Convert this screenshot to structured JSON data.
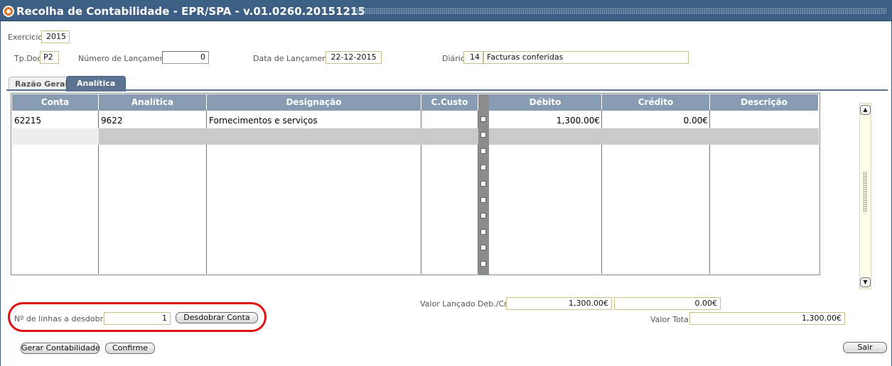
{
  "window": {
    "title": "Recolha de Contabilidade - EPR/SPA - v.01.0260.20151215"
  },
  "header": {
    "exercicio_label": "Exercicio",
    "exercicio_value": "2015",
    "tpdoc_label": "Tp.Doc.",
    "tpdoc_value": "P2",
    "numero_label": "Número de Lançamento:",
    "numero_value": "0",
    "data_label": "Data de Lançamento:",
    "data_value": "22-12-2015",
    "diario_label": "Diário:",
    "diario_code": "14",
    "diario_name": "Facturas conferidas"
  },
  "tabs": [
    {
      "label": "Razão Geral",
      "active": false
    },
    {
      "label": "Analítica",
      "active": true
    }
  ],
  "table": {
    "columns": [
      "Conta",
      "Analítica",
      "Designação",
      "C.Custo",
      "Débito",
      "Crédito",
      "Descrição"
    ],
    "rows": [
      {
        "conta": "62215",
        "analitica": "9622",
        "designacao": "Fornecimentos e serviços",
        "ccusto": "",
        "debito": "1,300.00€",
        "credito": "0.00€",
        "descricao": ""
      }
    ]
  },
  "totals": {
    "valor_lancado_label": "Valor Lançado Deb./Cre.",
    "valor_lancado_deb": "1,300.00€",
    "valor_lancado_cre": "0.00€",
    "valor_total_label": "Valor Total:",
    "valor_total": "1,300.00€"
  },
  "desdobrar": {
    "label": "Nº de linhas a desdobrar:",
    "value": "1",
    "button_label": "Desdobrar Conta"
  },
  "buttons": {
    "gerar": "Gerar Contabilidade",
    "confirme": "Confirme",
    "sair": "Sair"
  },
  "colors": {
    "titlebar": "#3d5f86",
    "header": "#879bb3",
    "highlight": "#e01010"
  }
}
